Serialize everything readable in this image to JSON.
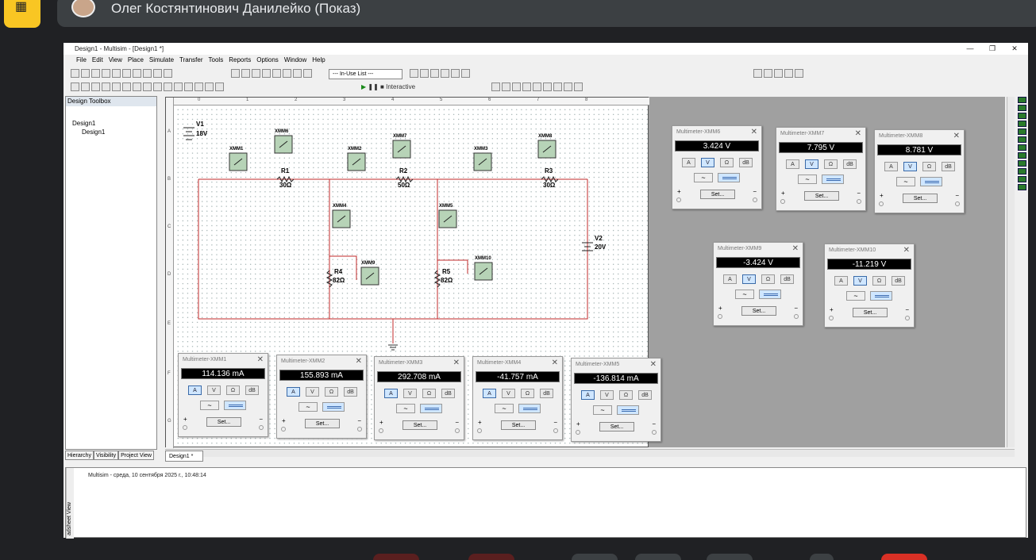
{
  "meet": {
    "presenter": "Олег Костянтинович Данилейко (Показ)"
  },
  "window": {
    "title": "Design1 - Multisim - [Design1 *]",
    "controls": [
      "—",
      "❐",
      "✕"
    ]
  },
  "menu": [
    "File",
    "Edit",
    "View",
    "Place",
    "Simulate",
    "Transfer",
    "Tools",
    "Reports",
    "Options",
    "Window",
    "Help"
  ],
  "toolbar": {
    "in_use_list": "--- In-Use List ---",
    "interactive": "Interactive"
  },
  "design_toolbox": {
    "title": "Design Toolbox",
    "tree_root": "Design1",
    "tree_child": "Design1"
  },
  "bottom_tabs": [
    "Hierarchy",
    "Visibility",
    "Project View"
  ],
  "sheet_tab": "Design1 *",
  "output": {
    "message": "Multisim  -  среда, 10 сентября 2025 г., 10:48:14",
    "side_label": "adsheet View"
  },
  "ruler": {
    "cols": [
      "0",
      "1",
      "2",
      "3",
      "4",
      "5",
      "6",
      "7",
      "8"
    ],
    "rows": [
      "A",
      "B",
      "C",
      "D",
      "E",
      "F",
      "G"
    ]
  },
  "schematic": {
    "sources": [
      {
        "name": "V1",
        "value": "18V"
      },
      {
        "name": "V2",
        "value": "20V"
      }
    ],
    "resistors": [
      {
        "name": "R1",
        "value": "30Ω"
      },
      {
        "name": "R2",
        "value": "50Ω"
      },
      {
        "name": "R3",
        "value": "30Ω"
      },
      {
        "name": "R4",
        "value": "82Ω"
      },
      {
        "name": "R5",
        "value": "82Ω"
      }
    ],
    "meters": [
      "XMM1",
      "XMM6",
      "XMM2",
      "XMM7",
      "XMM3",
      "XMM8",
      "XMM4",
      "XMM5",
      "XMM9",
      "XMM10"
    ]
  },
  "multimeters": [
    {
      "title": "Multimeter-XMM1",
      "reading": "114.136 mA",
      "mode": "A"
    },
    {
      "title": "Multimeter-XMM2",
      "reading": "155.893 mA",
      "mode": "A"
    },
    {
      "title": "Multimeter-XMM3",
      "reading": "292.708 mA",
      "mode": "A"
    },
    {
      "title": "Multimeter-XMM4",
      "reading": "-41.757 mA",
      "mode": "A"
    },
    {
      "title": "Multimeter-XMM5",
      "reading": "-136.814 mA",
      "mode": "A"
    },
    {
      "title": "Multimeter-XMM6",
      "reading": "3.424 V",
      "mode": "V"
    },
    {
      "title": "Multimeter-XMM7",
      "reading": "7.795 V",
      "mode": "V"
    },
    {
      "title": "Multimeter-XMM8",
      "reading": "8.781 V",
      "mode": "V"
    },
    {
      "title": "Multimeter-XMM9",
      "reading": "-3.424 V",
      "mode": "V"
    },
    {
      "title": "Multimeter-XMM10",
      "reading": "-11.219 V",
      "mode": "V"
    }
  ],
  "meter_buttons": {
    "amp": "A",
    "volt": "V",
    "ohm": "Ω",
    "db": "dB",
    "ac": "~",
    "set": "Set...",
    "plus": "+",
    "minus": "−"
  }
}
